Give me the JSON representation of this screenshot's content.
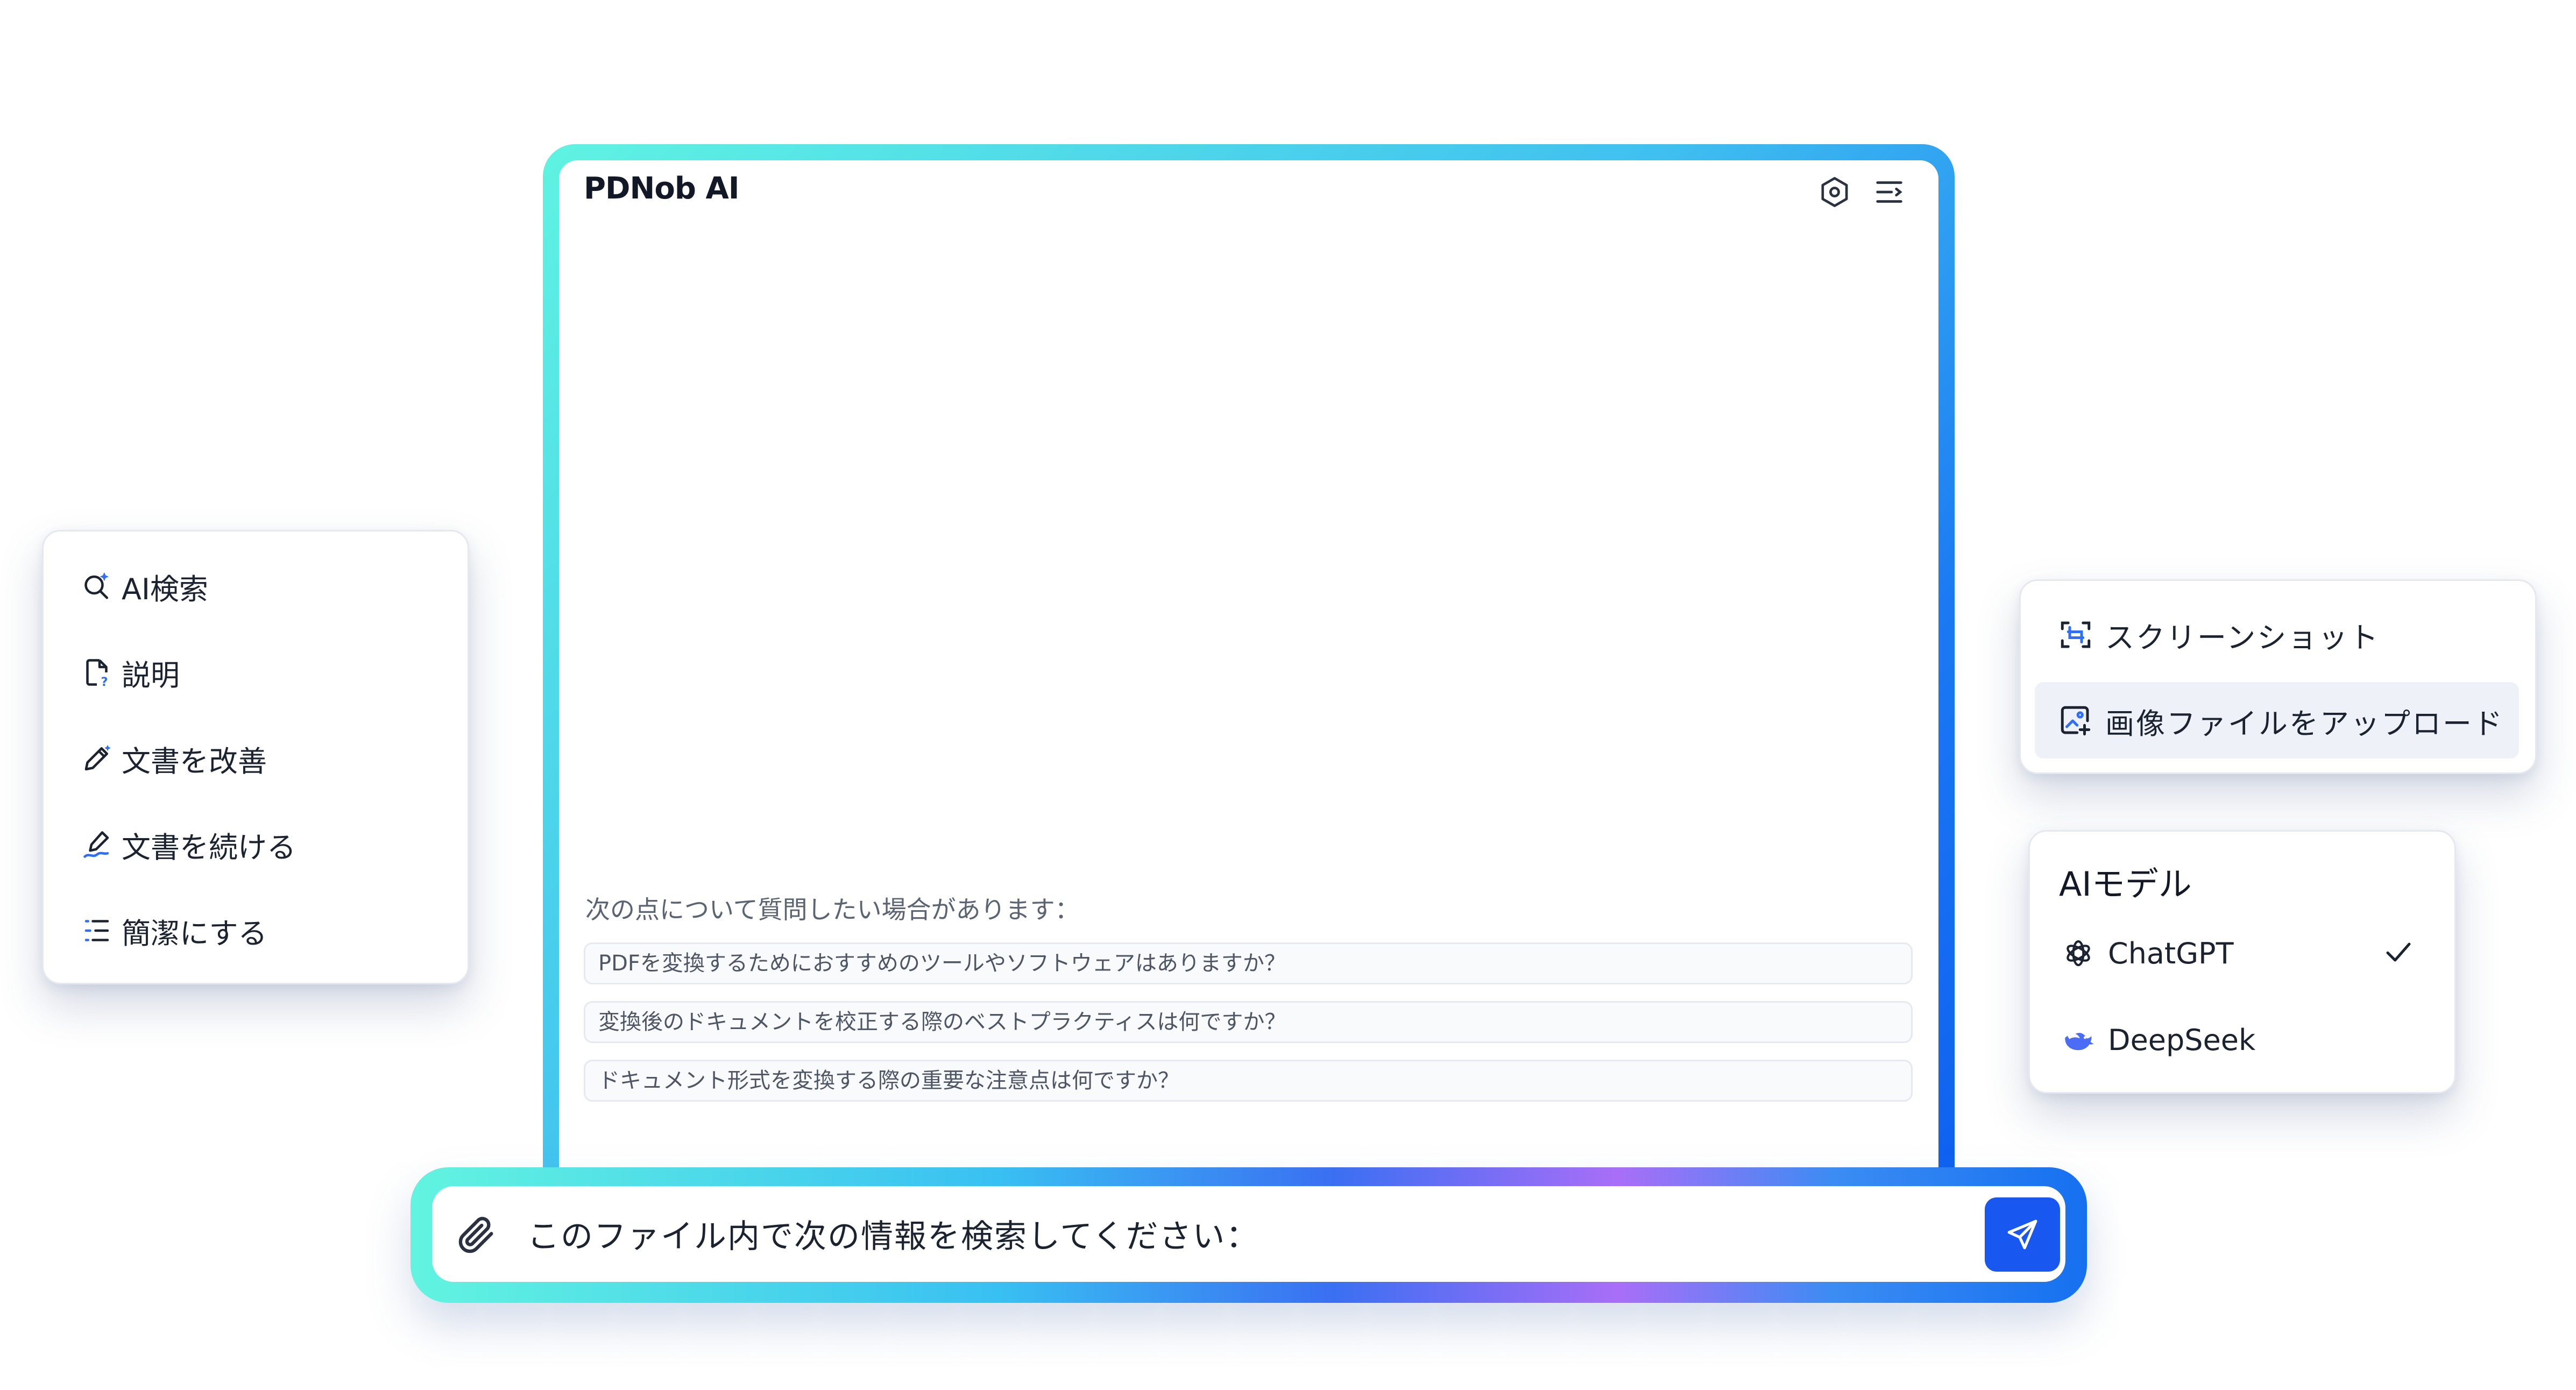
{
  "app": {
    "title": "PDNob AI"
  },
  "header": {
    "icons": [
      "settings-icon",
      "sidebar-menu-icon"
    ]
  },
  "suggestions": {
    "heading": "次の点について質問したい場合があります：",
    "items": [
      "PDFを変換するためにおすすめのツールやソフトウェアはありますか？",
      "変換後のドキュメントを校正する際のベストプラクティスは何ですか？",
      "ドキュメント形式を変換する際の重要な注意点は何ですか？"
    ]
  },
  "input": {
    "value": "このファイル内で次の情報を検索してください：",
    "attach_icon": "paperclip-icon",
    "send_icon": "send-icon"
  },
  "left_menu": {
    "items": [
      {
        "label": "AI検索",
        "icon": "ai-search-icon"
      },
      {
        "label": "説明",
        "icon": "explain-document-icon"
      },
      {
        "label": "文書を改善",
        "icon": "pen-improve-icon"
      },
      {
        "label": "文書を続ける",
        "icon": "continue-writing-icon"
      },
      {
        "label": "簡潔にする",
        "icon": "summarize-list-icon"
      }
    ]
  },
  "attach_menu": {
    "items": [
      {
        "label": "スクリーンショット",
        "icon": "screenshot-icon"
      },
      {
        "label": "画像ファイルをアップロード",
        "icon": "image-upload-icon",
        "selected": true
      }
    ]
  },
  "model_menu": {
    "title": "AIモデル",
    "items": [
      {
        "label": "ChatGPT",
        "icon": "chatgpt-icon",
        "selected": true
      },
      {
        "label": "DeepSeek",
        "icon": "deepseek-icon",
        "selected": false
      }
    ]
  },
  "colors": {
    "accent_blue": "#1858f0",
    "gradient_cyan": "#5ff3e2",
    "gradient_purple": "#a96ef7",
    "deepseek_blue": "#4a6cf7"
  }
}
